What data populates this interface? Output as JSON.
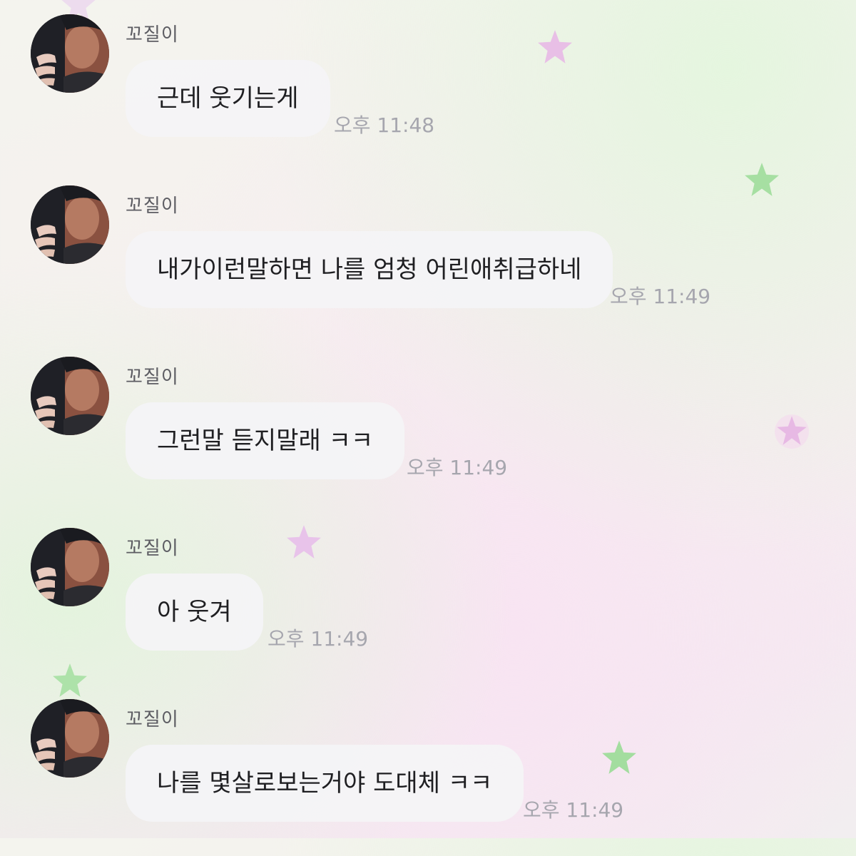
{
  "chat": {
    "messages": [
      {
        "sender": "꼬질이",
        "text": "근데 웃기는게",
        "time": "오후 11:48"
      },
      {
        "sender": "꼬질이",
        "text": "내가이런말하면 나를 엄청 어린애취급하네",
        "time": "오후 11:49"
      },
      {
        "sender": "꼬질이",
        "text": "그런말 듣지말래 ㅋㅋ",
        "time": "오후 11:49"
      },
      {
        "sender": "꼬질이",
        "text": "아 웃겨",
        "time": "오후 11:49"
      },
      {
        "sender": "꼬질이",
        "text": "나를 몇살로보는거야 도대체 ㅋㅋ",
        "time": "오후 11:49"
      }
    ]
  },
  "theme": {
    "bubble": "#f4f4f6",
    "name_color": "#5c5c62",
    "time_color": "#a6a6ae",
    "star_pink": "#e8bfe6",
    "star_green": "#a6dfa2"
  },
  "decorations": [
    "star-icon-pink",
    "star-icon-green"
  ]
}
